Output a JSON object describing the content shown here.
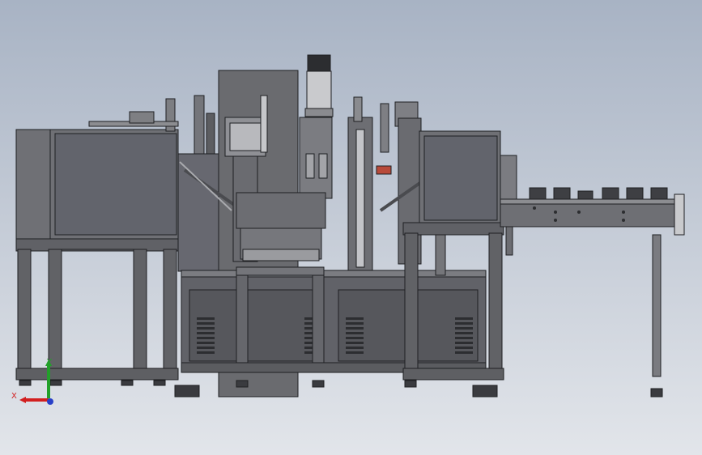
{
  "viewport": {
    "background_top": "#a8b3c4",
    "background_bottom": "#e2e5ea"
  },
  "colors": {
    "body": "#6d6d70",
    "body_dark": "#55565a",
    "panel": "#7a7b80",
    "window": "#5f6169",
    "outline": "#1e1f22",
    "chrome": "#c9cacd",
    "dark": "#2c2d30"
  },
  "triad": {
    "x_label": "X",
    "y_label": "Y",
    "x_color": "#d21f1f",
    "y_color": "#22a02a",
    "z_color": "#2840c8"
  }
}
